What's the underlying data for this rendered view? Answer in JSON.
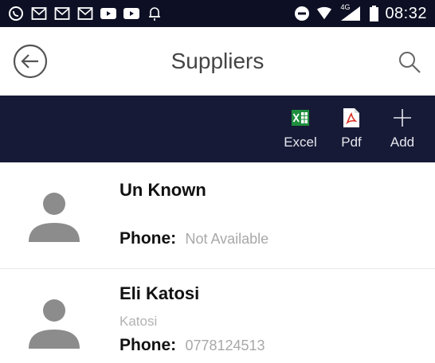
{
  "status_bar": {
    "time": "08:32",
    "network": "4G",
    "icons": [
      "whatsapp-icon",
      "mail-icon",
      "mail-icon",
      "mail-icon",
      "youtube-icon",
      "youtube-icon",
      "bell-icon"
    ]
  },
  "header": {
    "title": "Suppliers"
  },
  "toolbar": {
    "excel_label": "Excel",
    "pdf_label": "Pdf",
    "add_label": "Add"
  },
  "suppliers": [
    {
      "name": "Un Known",
      "company": "",
      "phone_label": "Phone:",
      "phone": "Not Available"
    },
    {
      "name": "Eli Katosi",
      "company": "Katosi",
      "phone_label": "Phone:",
      "phone": "0778124513"
    }
  ],
  "colors": {
    "status_bar_bg": "#0d1024",
    "toolbar_bg": "#161a36",
    "excel_green": "#1e8e3e",
    "pdf_red": "#d93025",
    "avatar_gray": "#8c8c8c"
  }
}
